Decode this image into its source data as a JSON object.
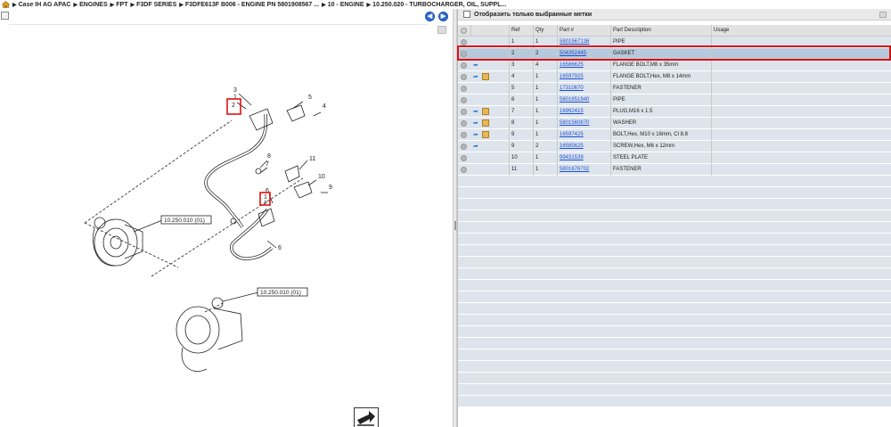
{
  "breadcrumb": [
    "Case IH AG APAC",
    "ENGINES",
    "FPT",
    "F3DF SERIES",
    "F3DFE613F B006 - ENGINE PN 5801908567 ...",
    "10 - ENGINE",
    "10.250.020 - TURBOCHARGER, OIL, SUPPL..."
  ],
  "diagram": {
    "callouts": [
      "1",
      "2",
      "3",
      "4",
      "5",
      "6",
      "7",
      "8",
      "9",
      "10",
      "11",
      "1",
      "2",
      "3",
      "6"
    ],
    "ref_boxes": [
      "10.250.010 (01)",
      "10.250.010 (01)"
    ]
  },
  "filter": {
    "label": "Отобразить только выбранные метки",
    "checked": false
  },
  "table": {
    "headers": {
      "ref": "Ref",
      "qty": "Qty",
      "part": "Part #",
      "desc": "Part Description",
      "usage": "Usage"
    },
    "rows": [
      {
        "ref": "1",
        "qty": "1",
        "part": "5801567136",
        "desc": "PIPE",
        "usage": "",
        "arrow": false,
        "box": false
      },
      {
        "ref": "2",
        "qty": "2",
        "part": "504352445",
        "desc": "GASKET",
        "usage": "",
        "arrow": false,
        "box": false
      },
      {
        "ref": "3",
        "qty": "4",
        "part": "16586625",
        "desc": "FLANGE BOLT,M8 x 35mm",
        "usage": "",
        "arrow": true,
        "box": false
      },
      {
        "ref": "4",
        "qty": "1",
        "part": "16597925",
        "desc": "FLANGE BOLT,Hex, M8 x 14mm",
        "usage": "",
        "arrow": true,
        "box": true
      },
      {
        "ref": "5",
        "qty": "1",
        "part": "17310670",
        "desc": "FASTENER",
        "usage": "",
        "arrow": false,
        "box": false
      },
      {
        "ref": "6",
        "qty": "1",
        "part": "5801651940",
        "desc": "PIPE",
        "usage": "",
        "arrow": false,
        "box": false
      },
      {
        "ref": "7",
        "qty": "1",
        "part": "16992415",
        "desc": "PLUG,M16 x 1.5",
        "usage": "",
        "arrow": true,
        "box": true
      },
      {
        "ref": "8",
        "qty": "1",
        "part": "5801560870",
        "desc": "WASHER",
        "usage": "",
        "arrow": true,
        "box": true
      },
      {
        "ref": "9",
        "qty": "1",
        "part": "16597425",
        "desc": "BOLT,Hex, M10 x 16mm, Cl 8.8",
        "usage": "",
        "arrow": true,
        "box": true
      },
      {
        "ref": "9",
        "qty": "2",
        "part": "16585625",
        "desc": "SCREW,Hex, M6 x 12mm",
        "usage": "",
        "arrow": true,
        "box": false
      },
      {
        "ref": "10",
        "qty": "1",
        "part": "99431539",
        "desc": "STEEL PLATE",
        "usage": "",
        "arrow": false,
        "box": false
      },
      {
        "ref": "11",
        "qty": "1",
        "part": "5801676702",
        "desc": "FASTENER",
        "usage": "",
        "arrow": false,
        "box": false
      }
    ],
    "selected_index": 1
  },
  "colors": {
    "link": "#1a4fd6",
    "highlight": "#dd1111",
    "row_bg": "#dde4ec",
    "row_selected": "#b8c9db",
    "nav_button": "#2f6fd1"
  },
  "icons": {
    "home": "home-icon",
    "back": "back-arrow-icon",
    "forward": "forward-arrow-icon",
    "exit": "exit-arrow-icon"
  }
}
